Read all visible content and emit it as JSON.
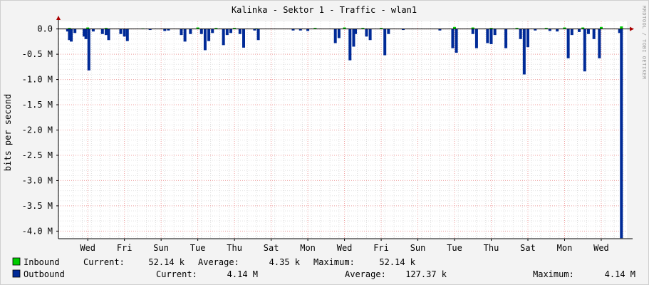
{
  "chart_data": {
    "type": "area",
    "title": "Kalinka - Sektor 1 - Traffic - wlan1",
    "ylabel": "bits per second",
    "watermark": "RRDTOOL / TOBI OETIKER",
    "ylim": [
      -4.15,
      0.15
    ],
    "yticks": [
      {
        "v": 0.0,
        "label": "0.0"
      },
      {
        "v": -0.5,
        "label": "-0.5 M"
      },
      {
        "v": -1.0,
        "label": "-1.0 M"
      },
      {
        "v": -1.5,
        "label": "-1.5 M"
      },
      {
        "v": -2.0,
        "label": "-2.0 M"
      },
      {
        "v": -2.5,
        "label": "-2.5 M"
      },
      {
        "v": -3.0,
        "label": "-3.0 M"
      },
      {
        "v": -3.5,
        "label": "-3.5 M"
      },
      {
        "v": -4.0,
        "label": "-4.0 M"
      }
    ],
    "xlim": [
      0,
      15.5
    ],
    "xticks": [
      {
        "v": 0.8,
        "label": "Wed"
      },
      {
        "v": 1.8,
        "label": "Fri"
      },
      {
        "v": 2.8,
        "label": "Sun"
      },
      {
        "v": 3.8,
        "label": "Tue"
      },
      {
        "v": 4.8,
        "label": "Thu"
      },
      {
        "v": 5.8,
        "label": "Sat"
      },
      {
        "v": 6.8,
        "label": "Mon"
      },
      {
        "v": 7.8,
        "label": "Wed"
      },
      {
        "v": 8.8,
        "label": "Fri"
      },
      {
        "v": 9.8,
        "label": "Sun"
      },
      {
        "v": 10.8,
        "label": "Tue"
      },
      {
        "v": 11.8,
        "label": "Thu"
      },
      {
        "v": 12.8,
        "label": "Sat"
      },
      {
        "v": 13.8,
        "label": "Mon"
      },
      {
        "v": 14.8,
        "label": "Wed"
      }
    ],
    "grid": true,
    "series": [
      {
        "name": "Inbound",
        "color": "#00cc00",
        "points": [
          [
            0.3,
            0.02
          ],
          [
            0.8,
            0.03
          ],
          [
            1.3,
            0.02
          ],
          [
            2.3,
            0.01
          ],
          [
            3.8,
            0.03
          ],
          [
            4.3,
            0.02
          ],
          [
            4.8,
            0.02
          ],
          [
            5.4,
            0.01
          ],
          [
            7.0,
            0.02
          ],
          [
            7.8,
            0.03
          ],
          [
            8.3,
            0.02
          ],
          [
            8.8,
            0.02
          ],
          [
            10.8,
            0.04
          ],
          [
            11.3,
            0.03
          ],
          [
            11.8,
            0.02
          ],
          [
            12.5,
            0.02
          ],
          [
            13.3,
            0.02
          ],
          [
            13.8,
            0.03
          ],
          [
            14.3,
            0.03
          ],
          [
            14.8,
            0.04
          ],
          [
            15.35,
            0.05
          ]
        ]
      },
      {
        "name": "Outbound",
        "color": "#002a97",
        "points": [
          [
            0.25,
            -0.05
          ],
          [
            0.3,
            -0.22
          ],
          [
            0.35,
            -0.25
          ],
          [
            0.45,
            -0.08
          ],
          [
            0.7,
            -0.15
          ],
          [
            0.75,
            -0.2
          ],
          [
            0.83,
            -0.82
          ],
          [
            0.95,
            -0.05
          ],
          [
            1.2,
            -0.1
          ],
          [
            1.3,
            -0.12
          ],
          [
            1.37,
            -0.22
          ],
          [
            1.7,
            -0.1
          ],
          [
            1.8,
            -0.15
          ],
          [
            1.88,
            -0.24
          ],
          [
            2.5,
            -0.02
          ],
          [
            2.9,
            -0.04
          ],
          [
            3.0,
            -0.03
          ],
          [
            3.35,
            -0.12
          ],
          [
            3.45,
            -0.25
          ],
          [
            3.6,
            -0.1
          ],
          [
            3.9,
            -0.1
          ],
          [
            4.0,
            -0.42
          ],
          [
            4.1,
            -0.24
          ],
          [
            4.2,
            -0.08
          ],
          [
            4.5,
            -0.32
          ],
          [
            4.6,
            -0.12
          ],
          [
            4.7,
            -0.08
          ],
          [
            4.95,
            -0.1
          ],
          [
            5.05,
            -0.37
          ],
          [
            5.35,
            -0.03
          ],
          [
            5.45,
            -0.22
          ],
          [
            6.4,
            -0.03
          ],
          [
            6.6,
            -0.03
          ],
          [
            6.8,
            -0.04
          ],
          [
            7.55,
            -0.28
          ],
          [
            7.65,
            -0.18
          ],
          [
            7.95,
            -0.62
          ],
          [
            8.05,
            -0.35
          ],
          [
            8.1,
            -0.1
          ],
          [
            8.4,
            -0.15
          ],
          [
            8.5,
            -0.22
          ],
          [
            8.9,
            -0.52
          ],
          [
            9.0,
            -0.1
          ],
          [
            9.4,
            -0.02
          ],
          [
            10.4,
            -0.03
          ],
          [
            10.75,
            -0.38
          ],
          [
            10.85,
            -0.47
          ],
          [
            11.3,
            -0.1
          ],
          [
            11.4,
            -0.38
          ],
          [
            11.7,
            -0.28
          ],
          [
            11.8,
            -0.3
          ],
          [
            11.9,
            -0.12
          ],
          [
            12.2,
            -0.38
          ],
          [
            12.6,
            -0.2
          ],
          [
            12.7,
            -0.9
          ],
          [
            12.8,
            -0.36
          ],
          [
            13.0,
            -0.03
          ],
          [
            13.4,
            -0.04
          ],
          [
            13.6,
            -0.05
          ],
          [
            13.9,
            -0.58
          ],
          [
            14.0,
            -0.12
          ],
          [
            14.2,
            -0.06
          ],
          [
            14.35,
            -0.84
          ],
          [
            14.45,
            -0.1
          ],
          [
            14.6,
            -0.2
          ],
          [
            14.75,
            -0.58
          ],
          [
            15.3,
            -0.08
          ],
          [
            15.35,
            -4.14
          ]
        ]
      }
    ],
    "legend": [
      {
        "name": "Inbound",
        "color": "#00cc00",
        "current_label": "Current:",
        "current": "52.14 k",
        "average_label": "Average:",
        "average": "4.35 k",
        "maximum_label": "Maximum:",
        "maximum": "52.14 k"
      },
      {
        "name": "Outbound",
        "color": "#002a97",
        "current_label": "Current:",
        "current": "4.14 M",
        "average_label": "Average:",
        "average": "127.37 k",
        "maximum_label": "Maximum:",
        "maximum": "4.14 M"
      }
    ]
  }
}
